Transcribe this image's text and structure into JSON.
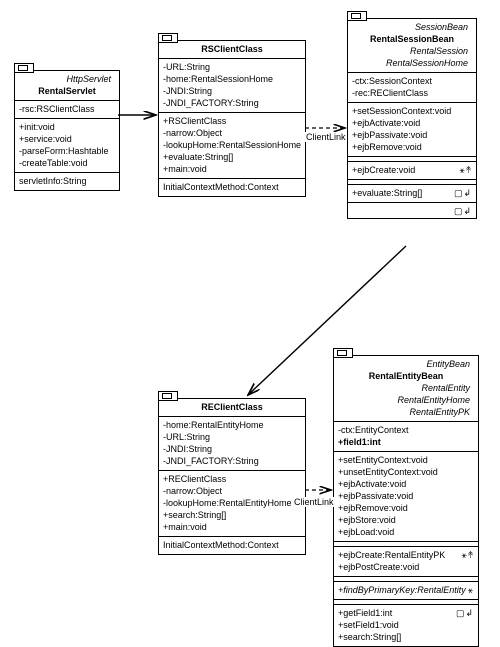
{
  "labels": {
    "clientLink": "ClientLink"
  },
  "rentalServlet": {
    "stereotype": "HttpServlet",
    "name": "RentalServlet",
    "attrs": [
      "-rsc:RSClientClass"
    ],
    "ops": [
      "+init:void",
      "+service:void",
      "-parseForm:Hashtable",
      "-createTable:void"
    ],
    "bottom": [
      "servletInfo:String"
    ]
  },
  "rsClient": {
    "name": "RSClientClass",
    "attrs": [
      "-URL:String",
      "-home:RentalSessionHome",
      "-JNDI:String",
      "-JNDI_FACTORY:String"
    ],
    "ops": [
      "+RSClientClass",
      "-narrow:Object",
      "-lookupHome:RentalSessionHome",
      "+evaluate:String[]",
      "+main:void"
    ],
    "bottom": [
      "InitialContextMethod:Context"
    ]
  },
  "rentalSession": {
    "stereotype": "SessionBean",
    "name": "RentalSessionBean",
    "impls": [
      "RentalSession",
      "RentalSessionHome"
    ],
    "attrs": [
      "-ctx:SessionContext",
      "-rec:REClientClass"
    ],
    "ops1": [
      "+setSessionContext:void",
      "+ejbActivate:void",
      "+ejbPassivate:void",
      "+ejbRemove:void"
    ],
    "ops2": [
      "+ejbCreate:void"
    ],
    "ops3": [
      "+evaluate:String[]"
    ]
  },
  "reClient": {
    "name": "REClientClass",
    "attrs": [
      "-home:RentalEntityHome",
      "-URL:String",
      "-JNDI:String",
      "-JNDI_FACTORY:String"
    ],
    "ops": [
      "+REClientClass",
      "-narrow:Object",
      "-lookupHome:RentalEntityHome",
      "+search:String[]",
      "+main:void"
    ],
    "bottom": [
      "InitialContextMethod:Context"
    ]
  },
  "rentalEntity": {
    "stereotype": "EntityBean",
    "name": "RentalEntityBean",
    "impls": [
      "RentalEntity",
      "RentalEntityHome",
      "RentalEntityPK"
    ],
    "attrs": [
      "-ctx:EntityContext",
      "+field1:int"
    ],
    "ops1": [
      "+setEntityContext:void",
      "+unsetEntityContext:void",
      "+ejbActivate:void",
      "+ejbPassivate:void",
      "+ejbRemove:void",
      "+ejbStore:void",
      "+ejbLoad:void"
    ],
    "ops2": [
      "+ejbCreate:RentalEntityPK",
      "+ejbPostCreate:void"
    ],
    "ops3": [
      "+findByPrimaryKey:RentalEntity"
    ],
    "ops4": [
      "+getField1:int",
      "+setField1:void",
      "+search:String[]"
    ]
  }
}
